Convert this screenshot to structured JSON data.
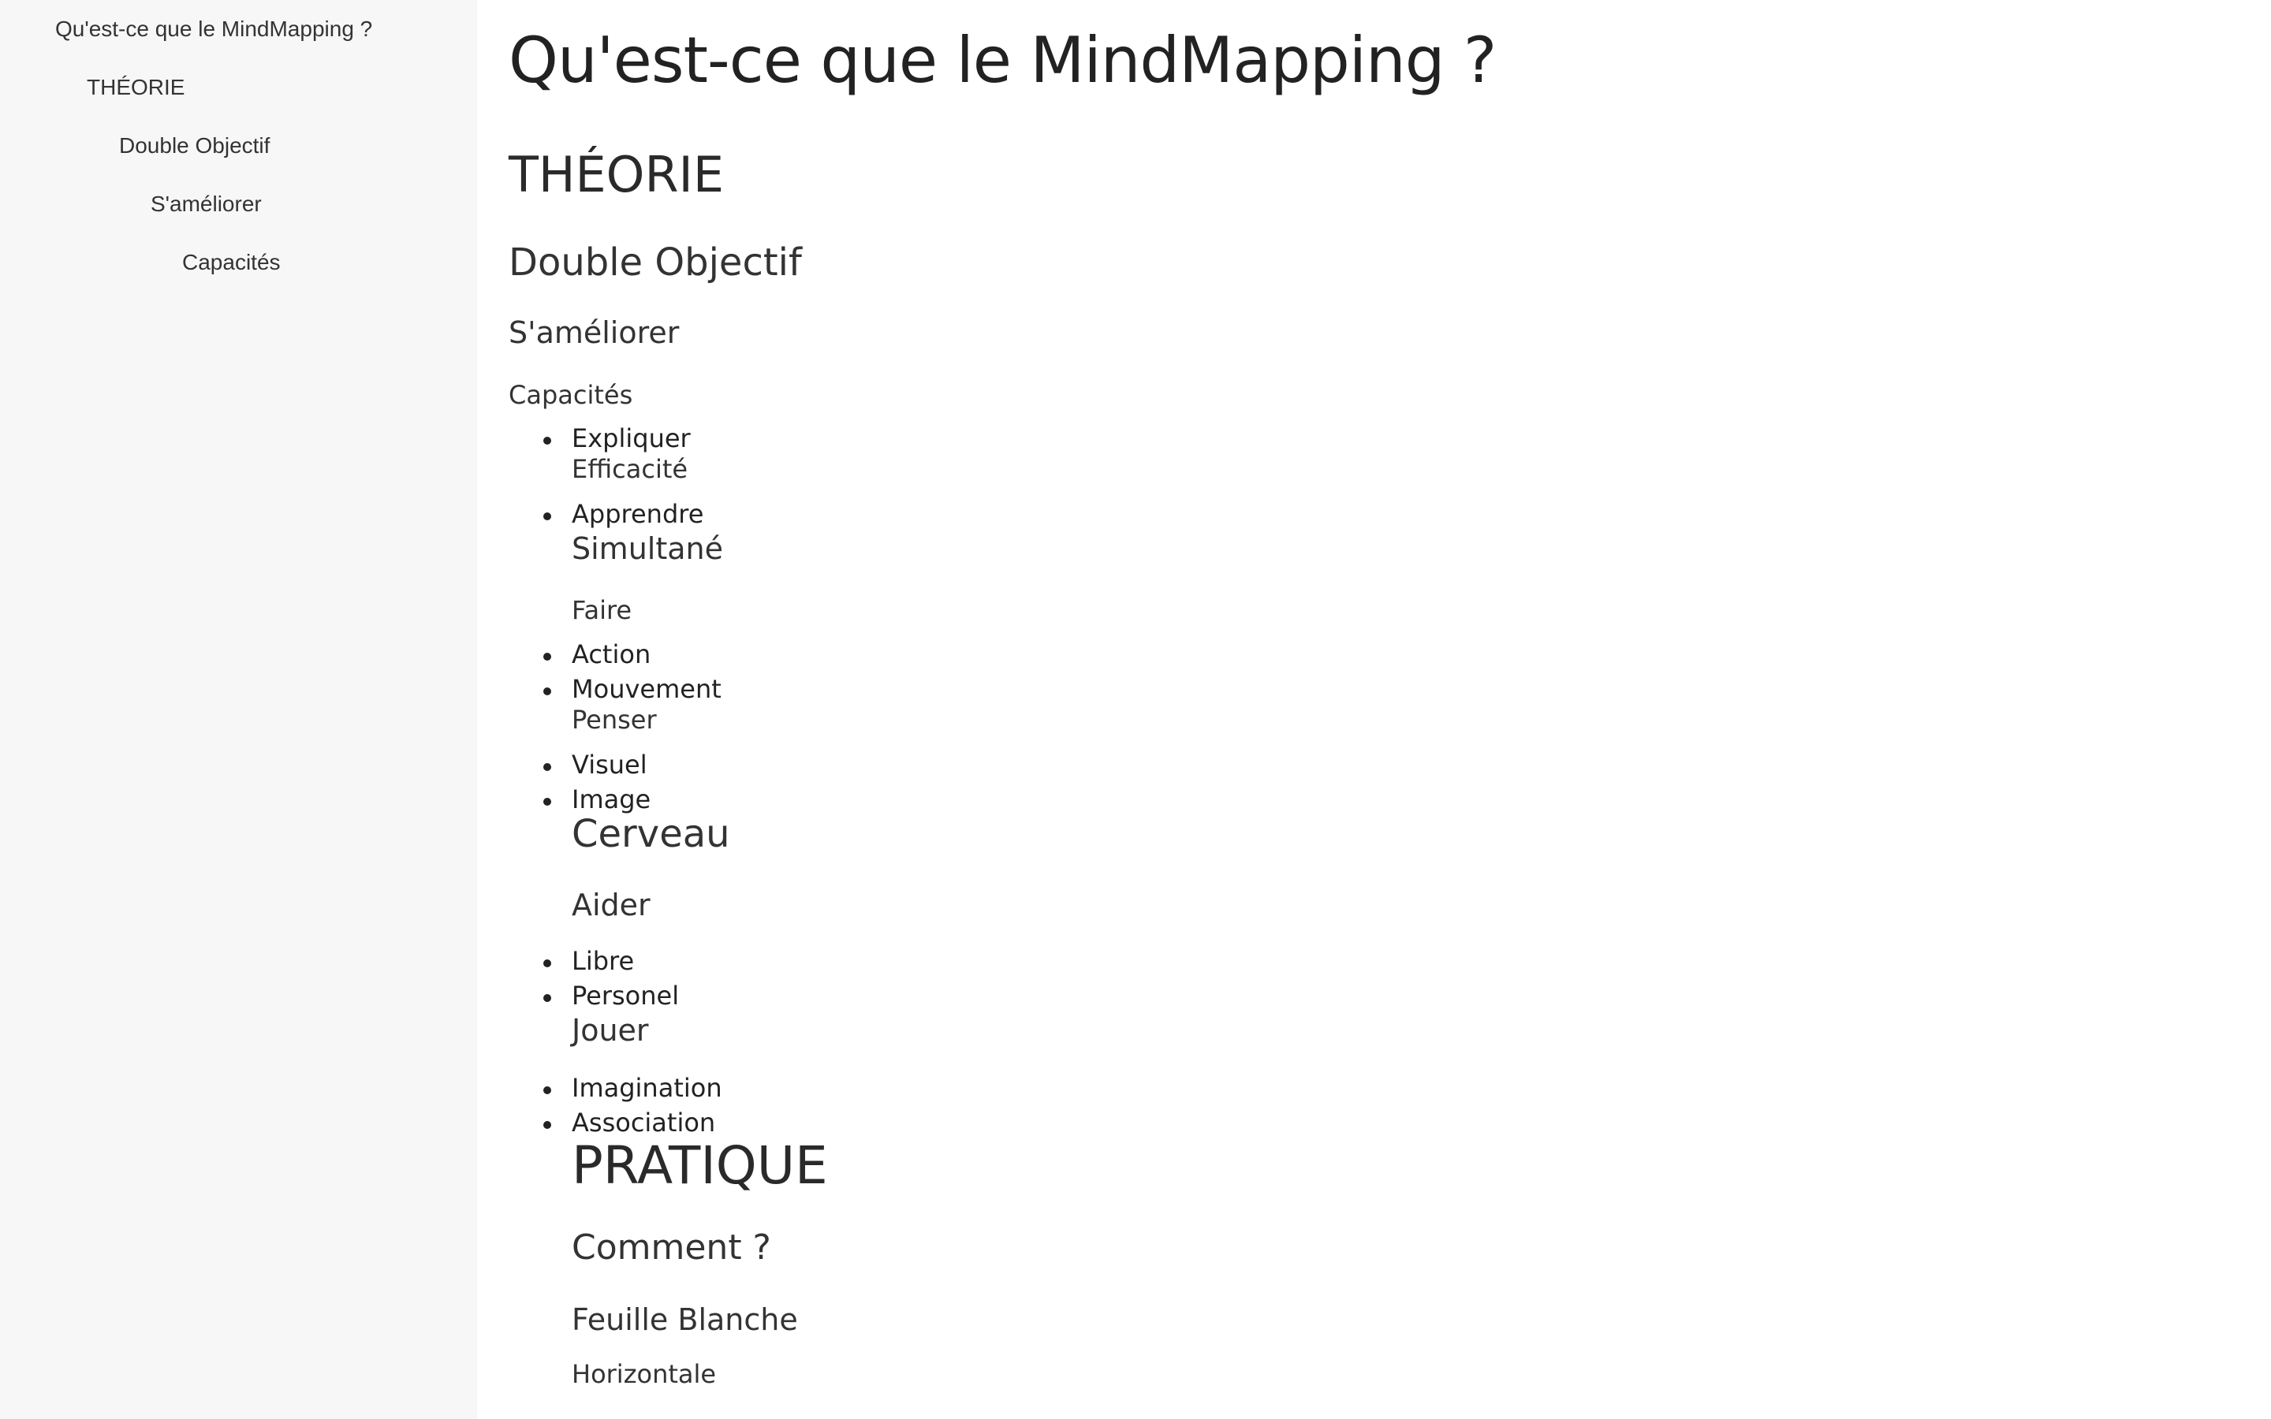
{
  "toc": {
    "items": [
      {
        "label": "Qu'est-ce que le MindMapping ?"
      },
      {
        "label": "THÉORIE"
      },
      {
        "label": "Double Objectif"
      },
      {
        "label": "S'améliorer"
      },
      {
        "label": "Capacités"
      }
    ]
  },
  "doc": {
    "title": "Qu'est-ce que le MindMapping ?",
    "theorie": "THÉORIE",
    "double_objectif": "Double Objectif",
    "sameliorer": "S'améliorer",
    "capacites": "Capacités",
    "expliquer": "Expliquer",
    "efficacite": "Efficacité",
    "apprendre": "Apprendre",
    "simultane": "Simultané",
    "faire": "Faire",
    "action": "Action",
    "mouvement": "Mouvement",
    "penser": "Penser",
    "visuel": "Visuel",
    "image": "Image",
    "cerveau": "Cerveau",
    "aider": "Aider",
    "libre": "Libre",
    "personel": "Personel",
    "jouer": "Jouer",
    "imagination": "Imagination",
    "association": "Association",
    "pratique": "PRATIQUE",
    "comment": "Comment ?",
    "feuille_blanche": "Feuille Blanche",
    "horizontale": "Horizontale"
  }
}
